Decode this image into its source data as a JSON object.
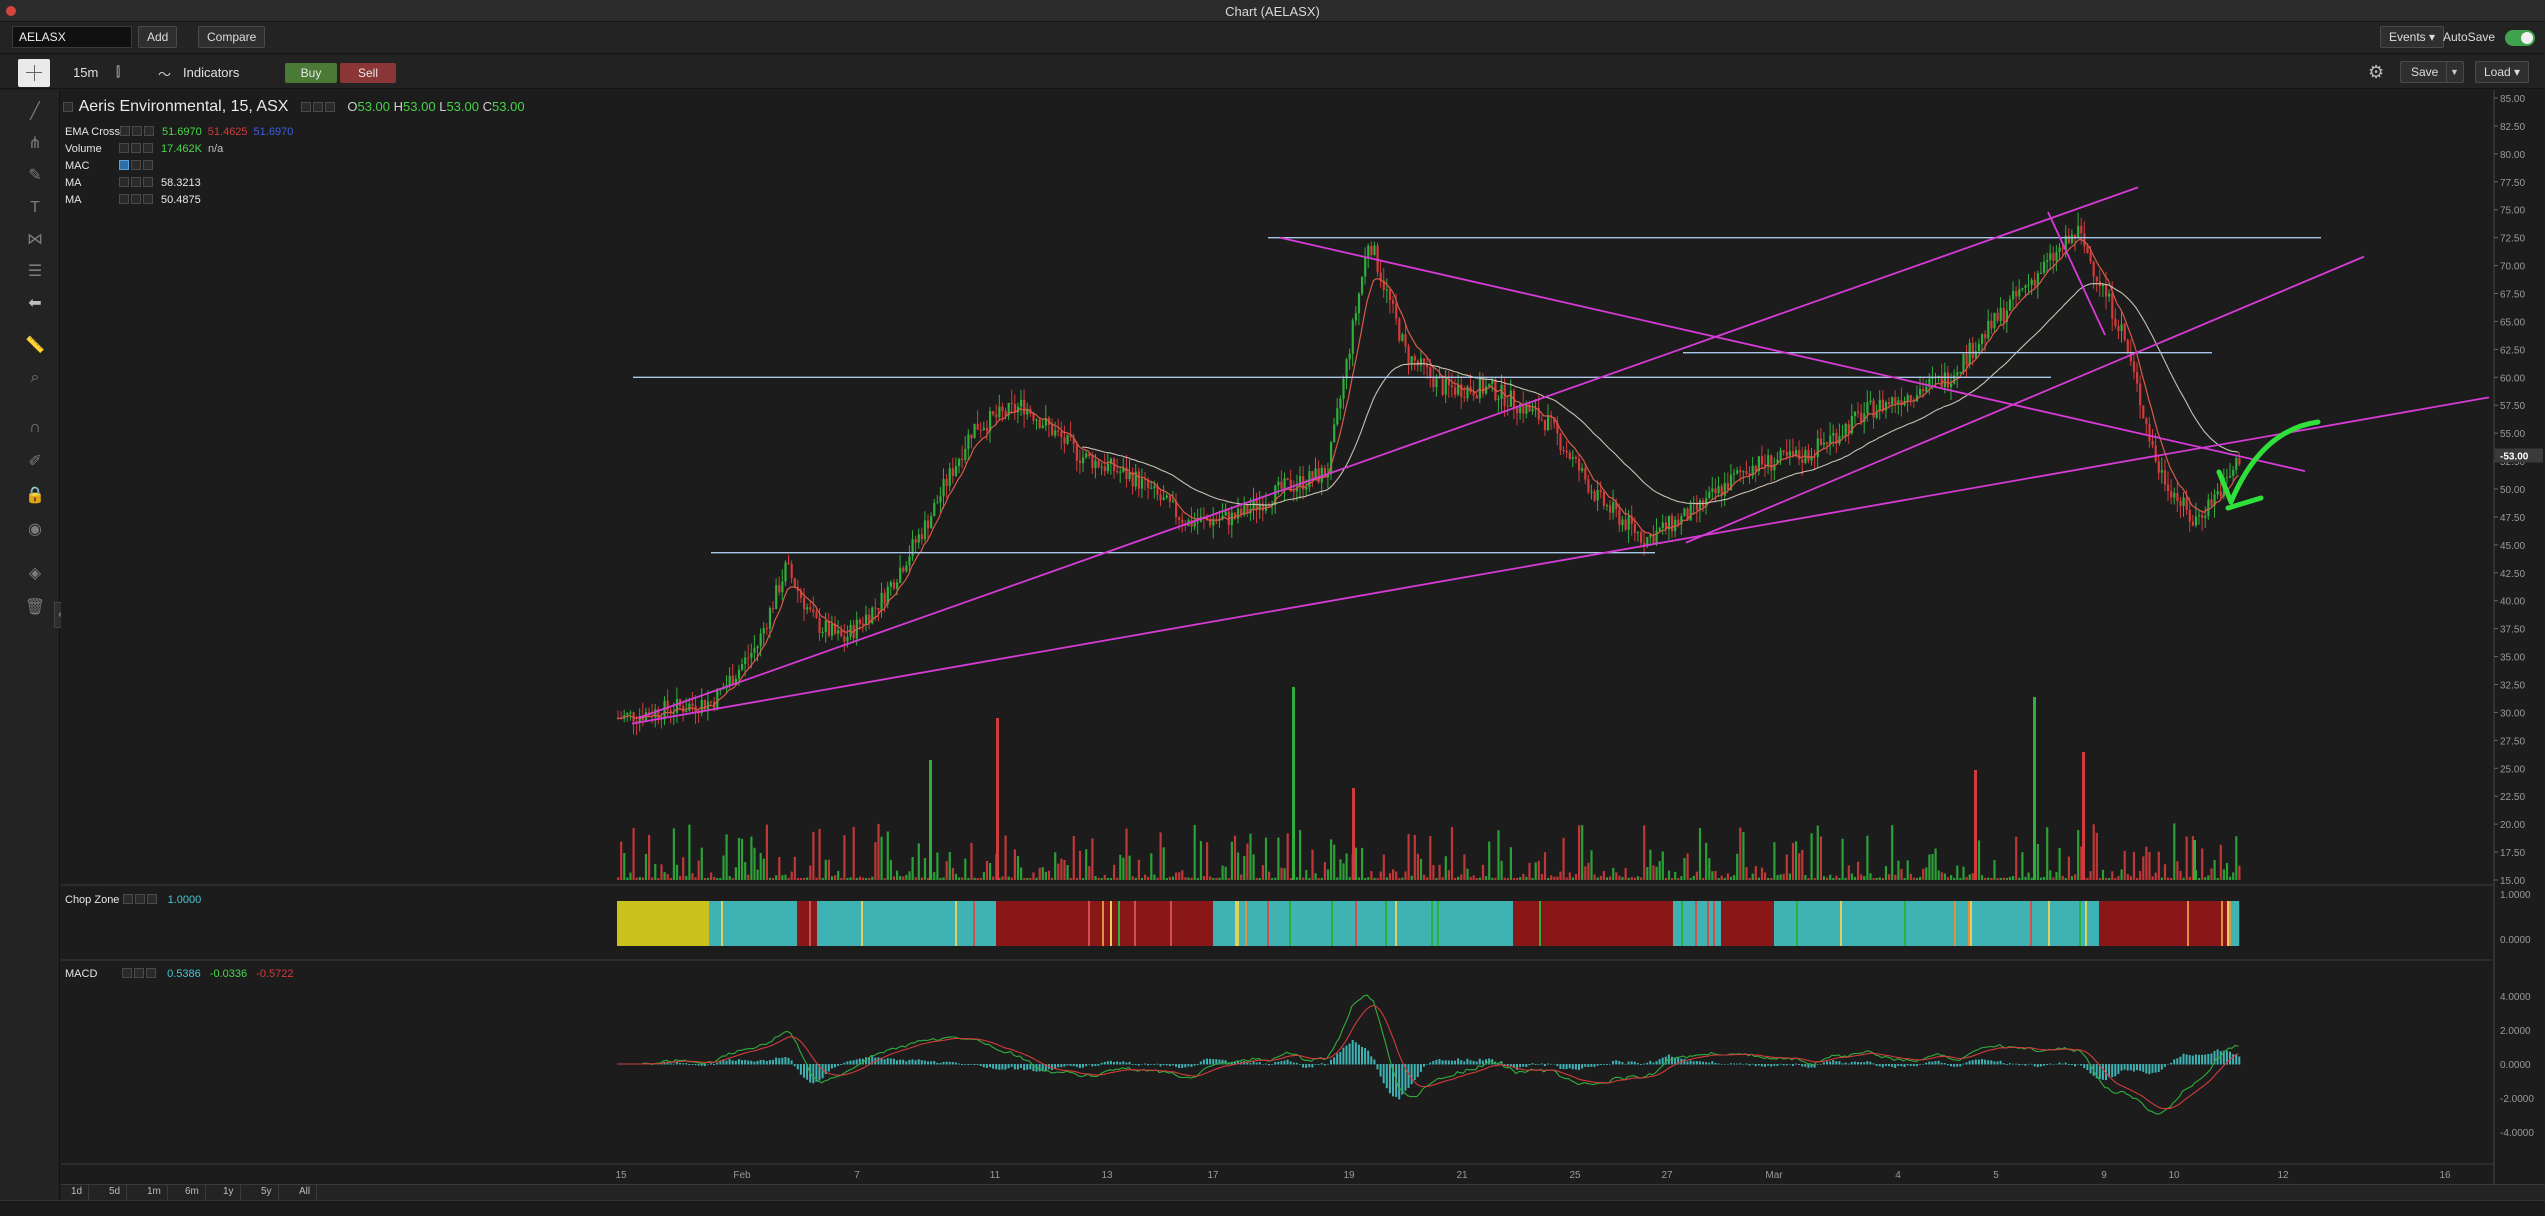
{
  "window": {
    "title": "Chart (AELASX)"
  },
  "symbolbar": {
    "symbol": "AELASX",
    "add_label": "Add",
    "compare_label": "Compare",
    "events_label": "Events ▾",
    "autosave_label": "AutoSave"
  },
  "toolbar": {
    "timeframe": "15m",
    "indicators_label": "Indicators",
    "buy_label": "Buy",
    "sell_label": "Sell",
    "save_label": "Save",
    "load_label": "Load ▾"
  },
  "legend": {
    "instrument": "Aeris Environmental, 15, ASX",
    "open_label": "O",
    "open": "53.00",
    "high_label": "H",
    "high": "53.00",
    "low_label": "L",
    "low": "53.00",
    "close_label": "C",
    "close": "53.00",
    "indicators": [
      {
        "name": "EMA Cross",
        "values": [
          "51.6970",
          "51.4625",
          "51.6970"
        ],
        "colors": [
          "#49d84b",
          "#d23b3b",
          "#3d5ee0"
        ]
      },
      {
        "name": "Volume",
        "values": [
          "17.462K",
          "n/a"
        ],
        "colors": [
          "#49d84b",
          "#bfbfbf"
        ]
      },
      {
        "name": "MAC",
        "values": [],
        "colors": []
      },
      {
        "name": "MA",
        "values": [
          "58.3213"
        ],
        "colors": [
          "#eaeaea"
        ]
      },
      {
        "name": "MA",
        "values": [
          "50.4875"
        ],
        "colors": [
          "#eaeaea"
        ]
      }
    ]
  },
  "chopzone": {
    "name": "Chop Zone",
    "value": "1.0000",
    "value_color": "#47c6d6"
  },
  "macd": {
    "name": "MACD",
    "values": [
      "0.5386",
      "-0.0336",
      "-0.5722"
    ],
    "colors": [
      "#47c6d6",
      "#49d84b",
      "#d23b3b"
    ]
  },
  "price_axis": {
    "labels": [
      "85.00",
      "82.50",
      "80.00",
      "77.50",
      "75.00",
      "72.50",
      "70.00",
      "67.50",
      "65.00",
      "62.50",
      "60.00",
      "57.50",
      "55.00",
      "52.50",
      "50.00",
      "47.50",
      "45.00",
      "42.50",
      "40.00",
      "37.50",
      "35.00",
      "32.50",
      "30.00",
      "27.50",
      "25.00",
      "22.50",
      "20.00",
      "17.50",
      "15.00"
    ],
    "current_price": "53.00"
  },
  "chop_axis": {
    "labels": [
      "1.0000",
      "0.0000"
    ]
  },
  "macd_axis": {
    "labels": [
      "4.0000",
      "2.0000",
      "0.0000",
      "-2.0000",
      "-4.0000"
    ]
  },
  "time_axis": {
    "labels": [
      "15",
      "Feb",
      "7",
      "11",
      "13",
      "17",
      "19",
      "21",
      "25",
      "27",
      "Mar",
      "4",
      "5",
      "9",
      "10",
      "12",
      "16"
    ]
  },
  "ranges": [
    "1d",
    "5d",
    "1m",
    "6m",
    "1y",
    "5y",
    "All"
  ],
  "colors": {
    "up": "#2fae3b",
    "down": "#d23b3b",
    "trendline": "#d63bd6",
    "hline": "#a9c7e8",
    "annotation": "#2fe03a",
    "ema_fast": "#d85a4a",
    "ma_slow": "#c8c0b0"
  },
  "chart_data": {
    "type": "candlestick",
    "title": "Aeris Environmental, 15, ASX",
    "ylim": [
      15,
      85
    ],
    "price_path": [
      [
        "15",
        29.5
      ],
      [
        "15",
        31
      ],
      [
        "Feb",
        36
      ],
      [
        "Feb",
        43
      ],
      [
        "Feb",
        38
      ],
      [
        "Feb",
        36.5
      ],
      [
        "7",
        40
      ],
      [
        "7",
        47
      ],
      [
        "7",
        55.5
      ],
      [
        "11",
        57.5
      ],
      [
        "11",
        53
      ],
      [
        "13",
        51
      ],
      [
        "13",
        47
      ],
      [
        "17",
        47.5
      ],
      [
        "17",
        50
      ],
      [
        "17",
        51.5
      ],
      [
        "19",
        72.5
      ],
      [
        "19",
        62
      ],
      [
        "19",
        59
      ],
      [
        "21",
        59
      ],
      [
        "21",
        56
      ],
      [
        "25",
        49
      ],
      [
        "25",
        45.5
      ],
      [
        "27",
        48
      ],
      [
        "27",
        52
      ],
      [
        "Mar",
        53
      ],
      [
        "Mar",
        57
      ],
      [
        "4",
        60
      ],
      [
        "5",
        68
      ],
      [
        "5",
        73
      ],
      [
        "9",
        64
      ],
      [
        "9",
        52
      ],
      [
        "10",
        47
      ],
      [
        "10",
        51
      ],
      [
        "10",
        53
      ]
    ],
    "horizontal_levels": [
      72.5,
      60.0,
      44.3,
      62.0
    ],
    "last_price": 53.0
  }
}
